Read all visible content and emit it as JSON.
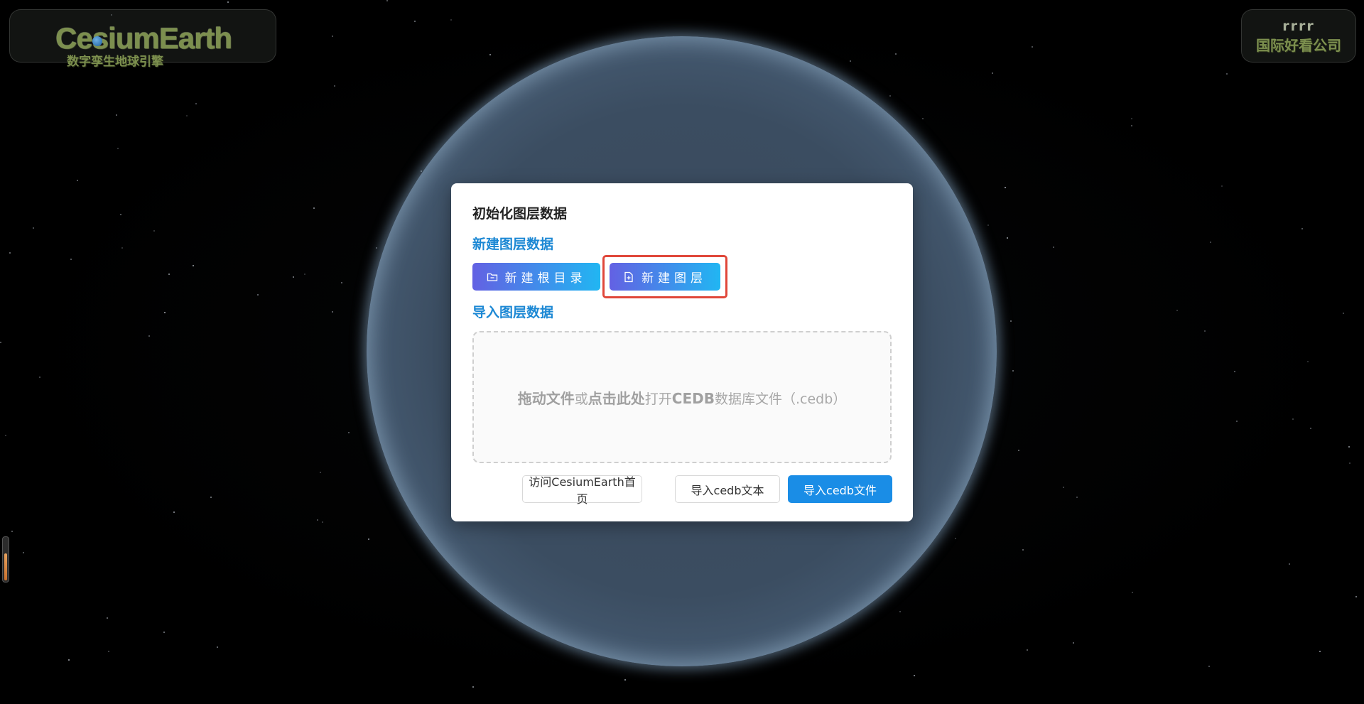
{
  "brand": {
    "title": "CesiumEarth",
    "subtitle": "数字孪生地球引擎"
  },
  "user": {
    "name": "rrrr",
    "company": "国际好看公司"
  },
  "dialog": {
    "title": "初始化图层数据",
    "new_section_title": "新建图层数据",
    "new_root_button": "新建根目录",
    "new_layer_button": "新建图层",
    "import_section_title": "导入图层数据",
    "dropzone": {
      "drag_text": "拖动文件",
      "or_text": "或",
      "click_text": "点击此处",
      "open_text": "打开",
      "cedb_text": "CEDB",
      "db_text": "数据库文件（.cedb）"
    },
    "visit_button": "访问CesiumEarth首页",
    "import_text_button": "导入cedb文本",
    "import_file_button": "导入cedb文件"
  },
  "icons": {
    "folder": "folder-icon",
    "new_file": "file-add-icon"
  },
  "colors": {
    "accent": "#1a8de6",
    "section_title": "#1c88d4",
    "highlight": "#e0473a",
    "brand_green": "#7c8f4e"
  }
}
